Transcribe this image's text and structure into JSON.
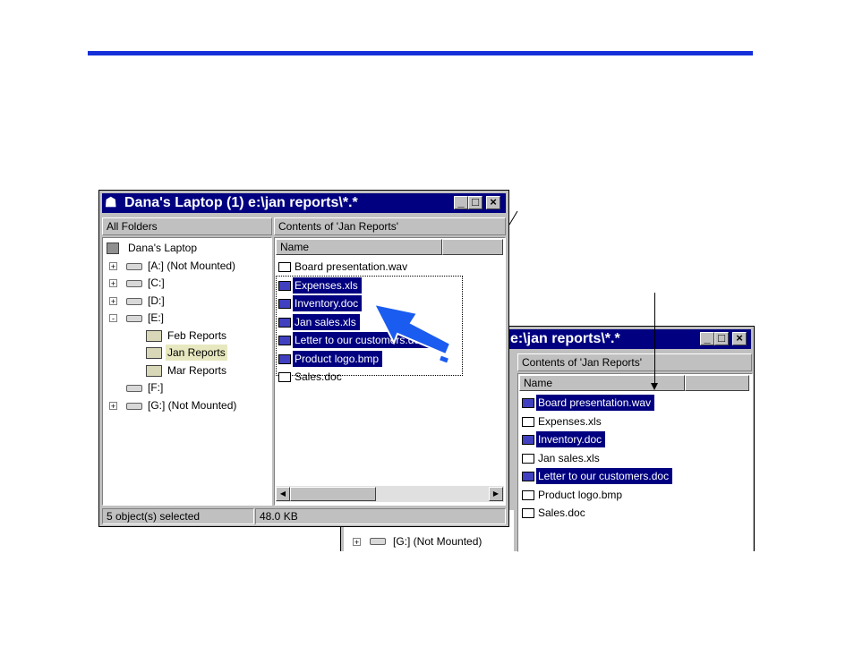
{
  "left_window": {
    "title": "Dana's Laptop (1) e:\\jan reports\\*.*",
    "folders_header": "All Folders",
    "contents_header": "Contents of 'Jan Reports'",
    "column_name": "Name",
    "tree": [
      {
        "label": "Dana's Laptop",
        "icon": "laptop-icon"
      },
      {
        "label": "[A:] (Not Mounted)",
        "icon": "drive-icon",
        "expander": "+"
      },
      {
        "label": "[C:]",
        "icon": "drive-icon",
        "expander": "+"
      },
      {
        "label": "[D:]",
        "icon": "drive-icon",
        "expander": "+"
      },
      {
        "label": "[E:]",
        "icon": "drive-icon",
        "expander": "-"
      },
      {
        "label": "Feb Reports",
        "icon": "folder-icon"
      },
      {
        "label": "Jan Reports",
        "icon": "open-folder-icon",
        "selected": true
      },
      {
        "label": "Mar Reports",
        "icon": "folder-icon"
      },
      {
        "label": "[F:]",
        "icon": "drive-icon"
      },
      {
        "label": "[G:] (Not Mounted)",
        "icon": "network-drive-icon",
        "expander": "+"
      }
    ],
    "files": [
      {
        "name": "Board presentation.wav",
        "selected": false
      },
      {
        "name": "Expenses.xls",
        "selected": true
      },
      {
        "name": "Inventory.doc",
        "selected": true
      },
      {
        "name": "Jan sales.xls",
        "selected": true
      },
      {
        "name": "Letter to our customers.doc",
        "selected": true
      },
      {
        "name": "Product logo.bmp",
        "selected": true
      },
      {
        "name": "Sales.doc",
        "selected": false
      }
    ],
    "status_selected": "5 object(s) selected",
    "status_size": "48.0 KB"
  },
  "right_window": {
    "title_fragment": "e:\\jan reports\\*.*",
    "contents_header": "Contents of 'Jan Reports'",
    "column_name": "Name",
    "files": [
      {
        "name": "Board presentation.wav",
        "selected": true
      },
      {
        "name": "Expenses.xls",
        "selected": false
      },
      {
        "name": "Inventory.doc",
        "selected": true
      },
      {
        "name": "Jan sales.xls",
        "selected": false
      },
      {
        "name": "Letter to our customers.doc",
        "selected": true
      },
      {
        "name": "Product logo.bmp",
        "selected": false
      },
      {
        "name": "Sales.doc",
        "selected": false
      }
    ],
    "tree_fragment": "[G:] (Not Mounted)"
  },
  "colors": {
    "title_bar": "#000080",
    "accent_bar": "#1530d8",
    "window_face": "#c0c0c0",
    "selection": "#000080"
  }
}
